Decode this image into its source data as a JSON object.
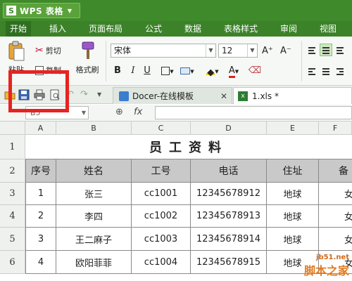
{
  "app": {
    "name": "WPS 表格",
    "logo_letter": "S"
  },
  "menu": [
    {
      "label": "开始",
      "active": true
    },
    {
      "label": "插入"
    },
    {
      "label": "页面布局"
    },
    {
      "label": "公式"
    },
    {
      "label": "数据"
    },
    {
      "label": "表格样式"
    },
    {
      "label": "审阅"
    },
    {
      "label": "视图"
    }
  ],
  "ribbon": {
    "paste_label": "粘贴",
    "cut_label": "剪切",
    "copy_label": "复制",
    "format_painter_label": "格式刷",
    "font_name": "宋体",
    "font_size": "12",
    "bold": "B",
    "italic": "I",
    "underline": "U",
    "font_color_letter": "A",
    "grow_font": "A⁺",
    "shrink_font": "A⁻"
  },
  "tabs": [
    {
      "label": "Docer-在线模板"
    },
    {
      "label": "1.xls *"
    }
  ],
  "formula_bar": {
    "name_box": "B5",
    "fx": "fx"
  },
  "columns": [
    "A",
    "B",
    "C",
    "D",
    "E",
    "F"
  ],
  "rows": [
    "1",
    "2",
    "3",
    "4",
    "5",
    "6"
  ],
  "sheet": {
    "title": "员工资料",
    "headers": [
      "序号",
      "姓名",
      "工号",
      "电话",
      "住址",
      "备"
    ],
    "data": [
      [
        "1",
        "张三",
        "cc1001",
        "12345678912",
        "地球",
        "女"
      ],
      [
        "2",
        "李四",
        "cc1002",
        "12345678913",
        "地球",
        "女"
      ],
      [
        "3",
        "王二麻子",
        "cc1003",
        "12345678914",
        "地球",
        "女"
      ],
      [
        "4",
        "欧阳菲菲",
        "cc1004",
        "12345678915",
        "地球",
        "女"
      ]
    ]
  },
  "watermark": {
    "url": "jb51.net",
    "name": "脚本之家"
  },
  "colors": {
    "title_bar": "#3f8a2b",
    "highlight": "#e8231f"
  }
}
